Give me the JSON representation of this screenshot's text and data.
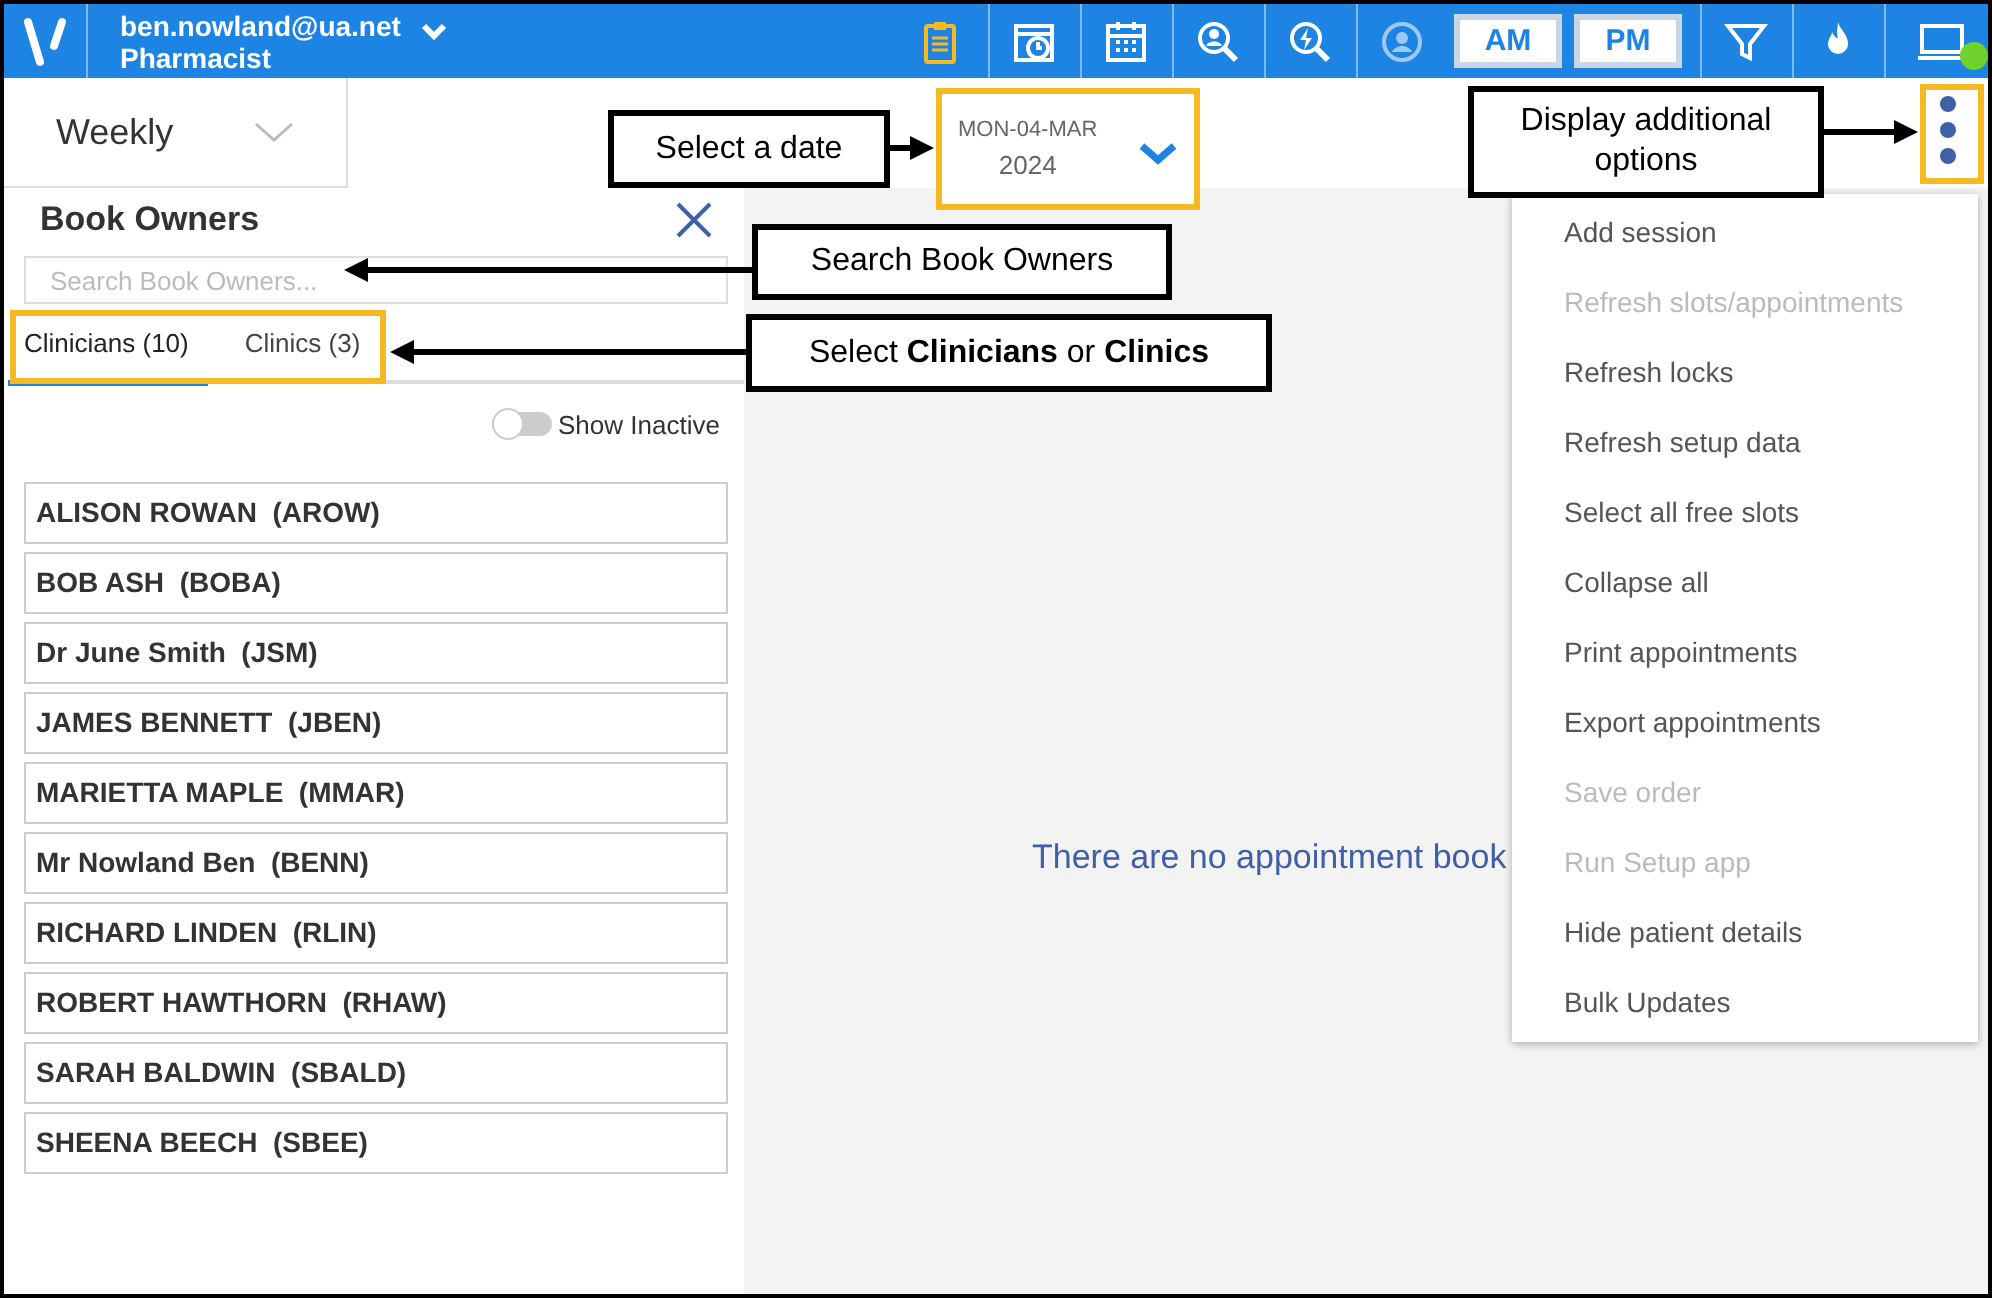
{
  "header": {
    "user": "ben.nowland@ua.net",
    "role": "Pharmacist",
    "toolbar": [
      {
        "kind": "clipboard"
      },
      {
        "kind": "alarm-calendar"
      },
      {
        "kind": "calendar"
      },
      {
        "kind": "person-search"
      },
      {
        "kind": "bolt-search"
      },
      {
        "kind": "person-off"
      },
      {
        "kind": "am",
        "label": "AM"
      },
      {
        "kind": "pm",
        "label": "PM"
      },
      {
        "kind": "filter"
      },
      {
        "kind": "flame"
      },
      {
        "kind": "monitor"
      }
    ]
  },
  "view_select": {
    "value": "Weekly"
  },
  "date_picker": {
    "day": "MON-04-MAR",
    "year": "2024"
  },
  "book_owners": {
    "title": "Book Owners",
    "search": {
      "placeholder": "Search Book Owners..."
    },
    "tabs": [
      {
        "label": "Clinicians (10)",
        "selected": true
      },
      {
        "label": "Clinics (3)",
        "selected": false
      }
    ],
    "show_inactive": {
      "label": "Show Inactive",
      "on": false
    },
    "owners": [
      "ALISON ROWAN  (AROW)",
      "BOB ASH  (BOBA)",
      "Dr June Smith  (JSM)",
      "JAMES BENNETT  (JBEN)",
      "MARIETTA MAPLE  (MMAR)",
      "Mr Nowland Ben  (BENN)",
      "RICHARD LINDEN  (RLIN)",
      "ROBERT HAWTHORN  (RHAW)",
      "SARAH BALDWIN  (SBALD)",
      "SHEENA BEECH  (SBEE)"
    ]
  },
  "empty_message": "There are no appointment book",
  "menu": [
    {
      "label": "Add session",
      "disabled": false
    },
    {
      "label": "Refresh slots/appointments",
      "disabled": true
    },
    {
      "label": "Refresh locks",
      "disabled": false
    },
    {
      "label": "Refresh setup data",
      "disabled": false
    },
    {
      "label": "Select all free slots",
      "disabled": false
    },
    {
      "label": "Collapse all",
      "disabled": false
    },
    {
      "label": "Print appointments",
      "disabled": false
    },
    {
      "label": "Export appointments",
      "disabled": false
    },
    {
      "label": "Save order",
      "disabled": true
    },
    {
      "label": "Run Setup app",
      "disabled": true
    },
    {
      "label": "Hide patient details",
      "disabled": false
    },
    {
      "label": "Bulk Updates",
      "disabled": false
    }
  ],
  "annotations": [
    "Select a date",
    "Display additional options",
    "Search Book Owners",
    "Select **Clinicians** or **Clinics**"
  ]
}
